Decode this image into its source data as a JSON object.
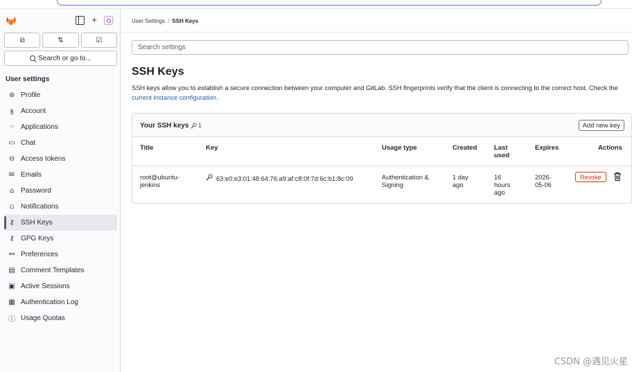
{
  "sidebar": {
    "top_icons": [
      "sidebar-toggle-icon",
      "plus-icon",
      "duo-ai-icon"
    ],
    "tabs": [
      {
        "icon": "issues-icon",
        "glyph": "⧉"
      },
      {
        "icon": "merge-request-icon",
        "glyph": "⇅"
      },
      {
        "icon": "todo-icon",
        "glyph": "☑"
      }
    ],
    "search_label": "Search or go to...",
    "section_title": "User settings",
    "items": [
      {
        "label": "Profile",
        "icon": "profile-icon",
        "glyph": "⊛"
      },
      {
        "label": "Account",
        "icon": "account-icon",
        "glyph": "ꝸ"
      },
      {
        "label": "Applications",
        "icon": "applications-icon",
        "glyph": "⁘"
      },
      {
        "label": "Chat",
        "icon": "chat-icon",
        "glyph": "▭"
      },
      {
        "label": "Access tokens",
        "icon": "token-icon",
        "glyph": "⊖"
      },
      {
        "label": "Emails",
        "icon": "mail-icon",
        "glyph": "✉"
      },
      {
        "label": "Password",
        "icon": "lock-icon",
        "glyph": "🔒"
      },
      {
        "label": "Notifications",
        "icon": "notifications-icon",
        "glyph": "⩍"
      },
      {
        "label": "SSH Keys",
        "icon": "key-icon",
        "glyph": "⚷"
      },
      {
        "label": "GPG Keys",
        "icon": "key-icon",
        "glyph": "⚷"
      },
      {
        "label": "Preferences",
        "icon": "preferences-icon",
        "glyph": "⚯"
      },
      {
        "label": "Comment Templates",
        "icon": "comment-icon",
        "glyph": "▤"
      },
      {
        "label": "Active Sessions",
        "icon": "monitor-icon",
        "glyph": "▣"
      },
      {
        "label": "Authentication Log",
        "icon": "log-icon",
        "glyph": "▦"
      },
      {
        "label": "Usage Quotas",
        "icon": "quota-icon",
        "glyph": "ⓘ"
      }
    ],
    "active_item": "SSH Keys"
  },
  "breadcrumb": {
    "parent": "User Settings",
    "separator": "/",
    "current": "SSH Keys"
  },
  "search": {
    "placeholder": "Search settings"
  },
  "page": {
    "title": "SSH Keys",
    "description_before": "SSH keys allow you to establish a secure connection between your computer and GitLab. SSH fingerprints verify that the client is connecting to the correct host. Check the ",
    "description_link": "current instance configuration",
    "description_after": "."
  },
  "keys_card": {
    "title": "Your SSH keys",
    "count": "1",
    "add_button": "Add new key",
    "columns": {
      "title": "Title",
      "key": "Key",
      "usage_type": "Usage type",
      "created": "Created",
      "last_used": "Last used",
      "expires": "Expires",
      "actions": "Actions"
    },
    "rows": [
      {
        "title": "root@ubuntu-jenkins",
        "key": "63:e0:e3:01:48:64:76:a9:af:c8:0f:7d:6c:b1:8c:09",
        "usage_type": "Authentication & Signing",
        "created": "1 day ago",
        "last_used": "16 hours ago",
        "expires": "2026-05-06",
        "revoke_label": "Revoke"
      }
    ]
  },
  "watermark": "CSDN @遇见火星",
  "colors": {
    "link": "#1f5fb7",
    "danger": "#dd2b0e",
    "logo_orange": "#e24329",
    "ai_purple": "#a23cc4"
  }
}
